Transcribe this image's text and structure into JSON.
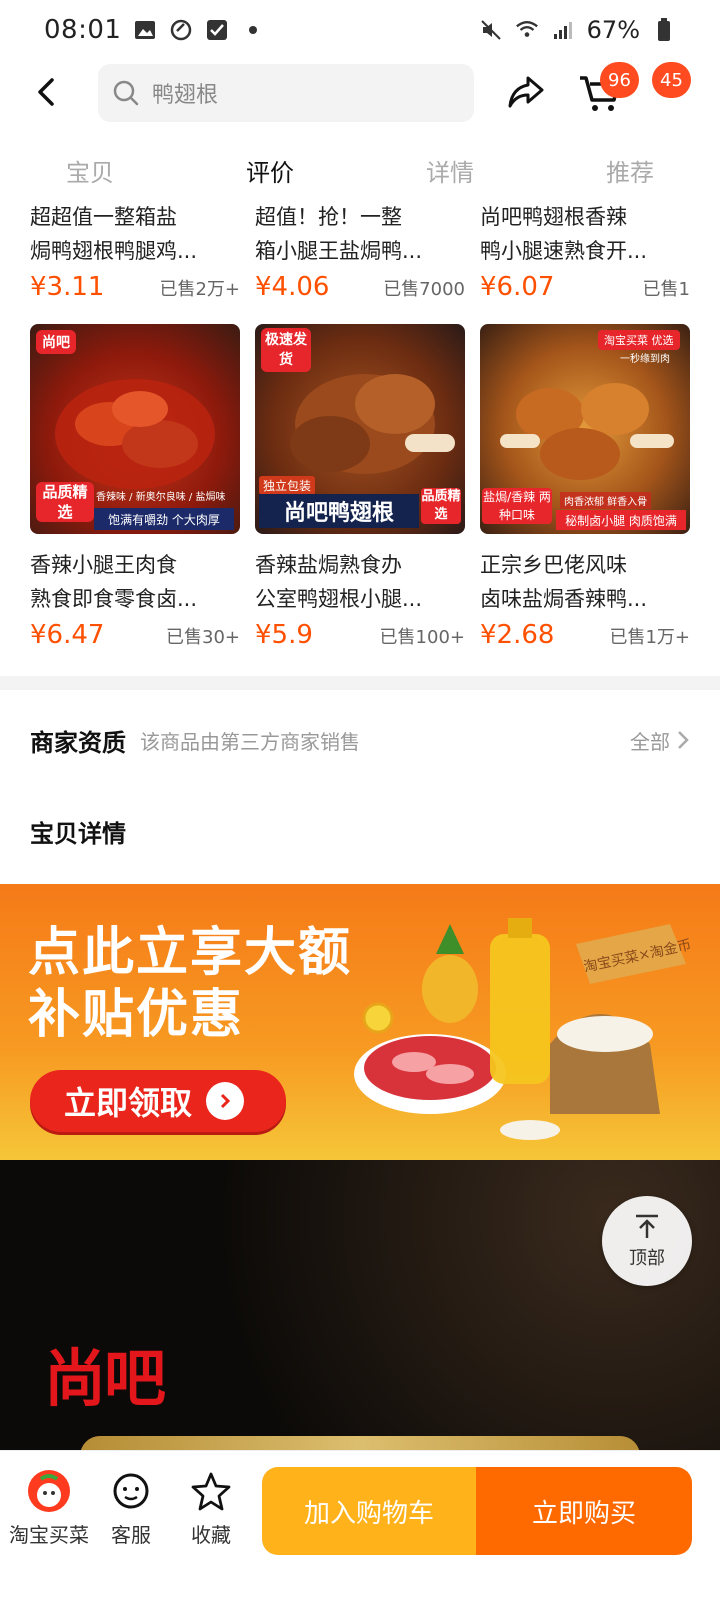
{
  "status": {
    "time": "08:01",
    "battery": "67%"
  },
  "nav": {
    "search_text": "鸭翅根",
    "cart_badge": "96",
    "msg_badge": "45"
  },
  "tabs": [
    {
      "label": "宝贝"
    },
    {
      "label": "评价"
    },
    {
      "label": "详情"
    },
    {
      "label": "推荐"
    }
  ],
  "products_top": [
    {
      "title_line1": "超超值一整箱盐",
      "title_line2": "焗鸭翅根鸭腿鸡...",
      "price": "¥3.11",
      "sold": "已售2万+"
    },
    {
      "title_line1": "超值！抢！一整",
      "title_line2": "箱小腿王盐焗鸭...",
      "price": "¥4.06",
      "sold": "已售7000"
    },
    {
      "title_line1": "尚吧鸭翅根香辣",
      "title_line2": "鸭小腿速熟食开...",
      "price": "¥6.07",
      "sold": "已售1"
    }
  ],
  "image_tags": {
    "img1_logo": "尚吧",
    "img1_badge": "品质精选",
    "img1_tags": "香辣味 / 新奥尔良味 / 盐焗味",
    "img1_banner": "饱满有嚼劲 个大肉厚",
    "img2_top": "极速发货",
    "img2_pack": "独立包装",
    "img2_banner": "尚吧鸭翅根",
    "img2_badge": "品质精选",
    "img3_top": "淘宝买菜 优选",
    "img3_sub": "一秒缘到肉",
    "img3_badge": "盐焗/香辣 两种口味",
    "img3_tags": "肉香浓郁 鲜香入骨",
    "img3_banner": "秘制卤小腿 肉质饱满"
  },
  "products_bottom": [
    {
      "title_line1": "香辣小腿王肉食",
      "title_line2": "熟食即食零食卤...",
      "price": "¥6.47",
      "sold": "已售30+"
    },
    {
      "title_line1": "香辣盐焗熟食办",
      "title_line2": "公室鸭翅根小腿...",
      "price": "¥5.9",
      "sold": "已售100+"
    },
    {
      "title_line1": "正宗乡巴佬风味",
      "title_line2": "卤味盐焗香辣鸭...",
      "price": "¥2.68",
      "sold": "已售1万+"
    }
  ],
  "merchant": {
    "title": "商家资质",
    "desc": "该商品由第三方商家销售",
    "all": "全部"
  },
  "detail": {
    "title": "宝贝详情"
  },
  "promo": {
    "line1": "点此立享大额",
    "line2": "补贴优惠",
    "cta": "立即领取",
    "sign": "淘宝买菜×淘金币"
  },
  "brand": {
    "logo": "尚吧"
  },
  "to_top": {
    "label": "顶部"
  },
  "bottom_bar": {
    "store": "淘宝买菜",
    "service": "客服",
    "favorite": "收藏",
    "add_to_cart": "加入购物车",
    "buy_now": "立即购买"
  },
  "colors": {
    "price": "#ff5000",
    "cart_btn": "#ffb21a",
    "buy_btn": "#ff6a00",
    "badge": "#ff4b1f"
  }
}
